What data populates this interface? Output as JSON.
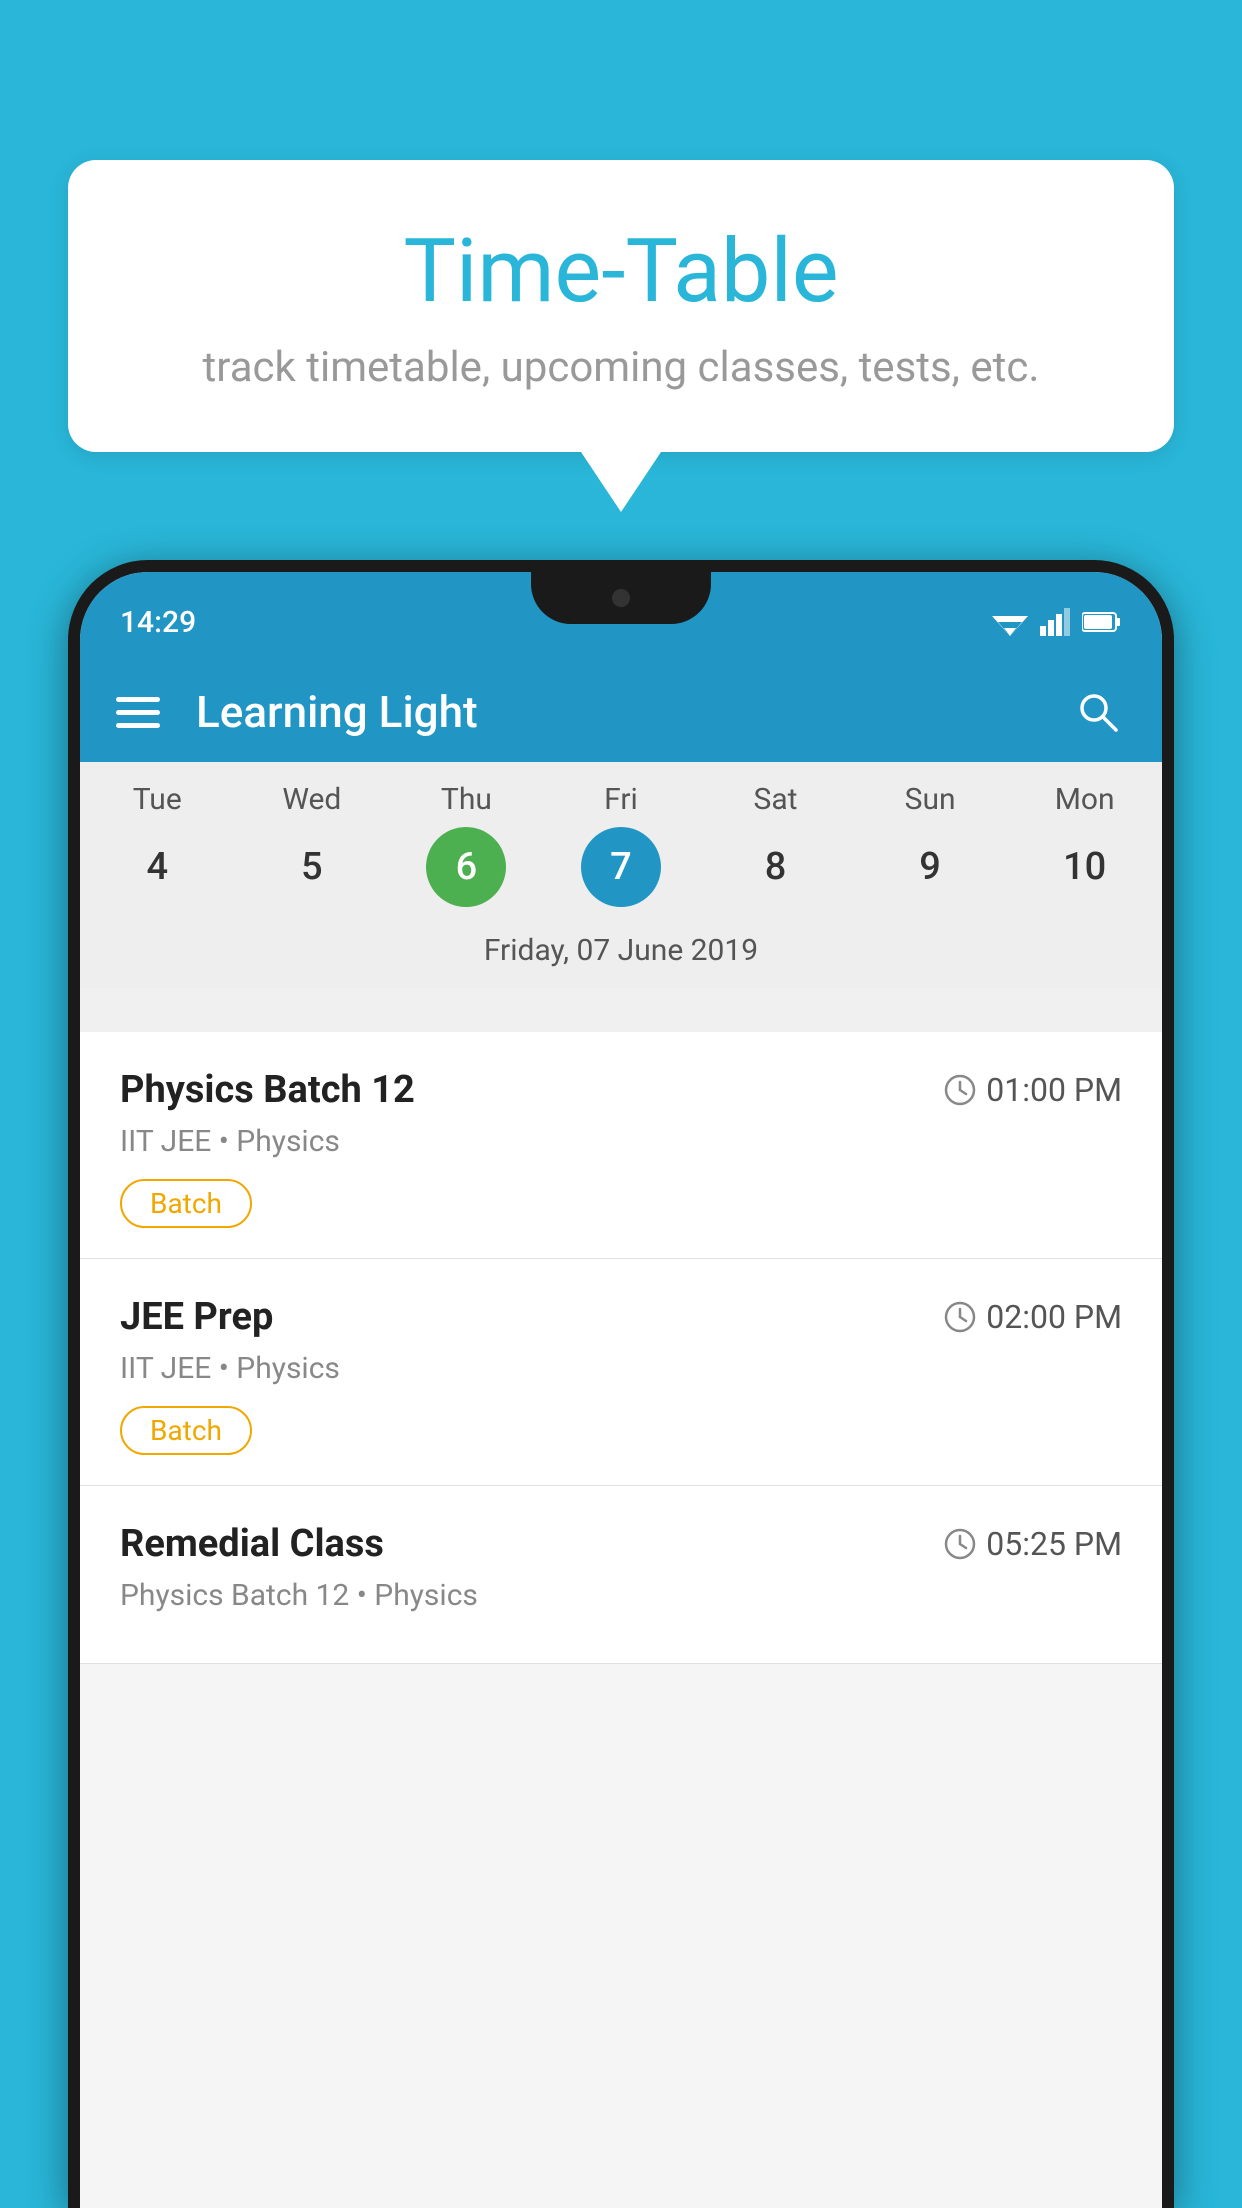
{
  "background_color": "#29b6d8",
  "speech_bubble": {
    "title": "Time-Table",
    "subtitle": "track timetable, upcoming classes, tests, etc."
  },
  "phone": {
    "status_bar": {
      "time": "14:29"
    },
    "app_bar": {
      "title": "Learning Light"
    },
    "calendar": {
      "days": [
        {
          "label": "Tue",
          "number": "4"
        },
        {
          "label": "Wed",
          "number": "5"
        },
        {
          "label": "Thu",
          "number": "6",
          "state": "today"
        },
        {
          "label": "Fri",
          "number": "7",
          "state": "selected"
        },
        {
          "label": "Sat",
          "number": "8"
        },
        {
          "label": "Sun",
          "number": "9"
        },
        {
          "label": "Mon",
          "number": "10"
        }
      ],
      "selected_date_label": "Friday, 07 June 2019"
    },
    "classes": [
      {
        "name": "Physics Batch 12",
        "time": "01:00 PM",
        "meta": "IIT JEE • Physics",
        "badge": "Batch"
      },
      {
        "name": "JEE Prep",
        "time": "02:00 PM",
        "meta": "IIT JEE • Physics",
        "badge": "Batch"
      },
      {
        "name": "Remedial Class",
        "time": "05:25 PM",
        "meta": "Physics Batch 12 • Physics",
        "badge": ""
      }
    ]
  },
  "icons": {
    "menu": "☰",
    "search": "🔍",
    "clock": "🕐"
  }
}
